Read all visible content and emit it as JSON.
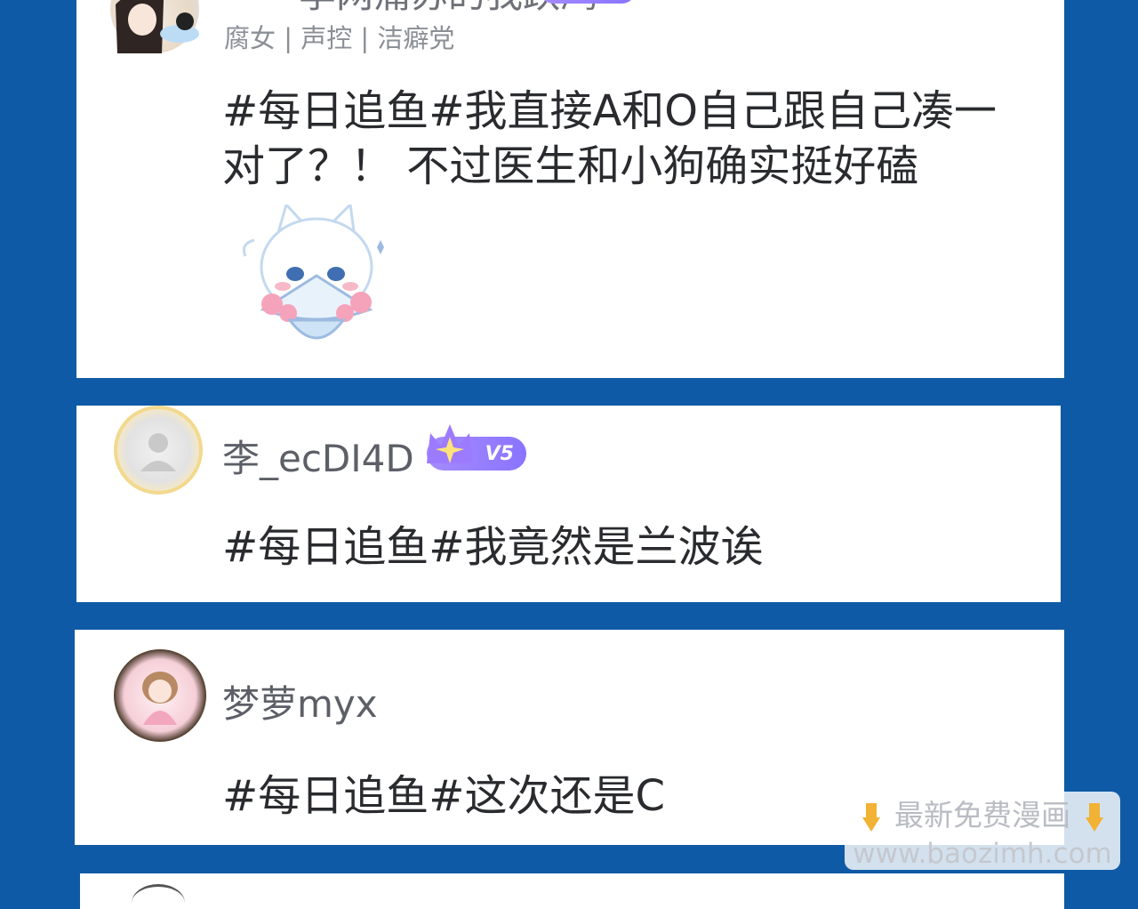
{
  "comments": [
    {
      "username": "李网痛苏的我跃鸿",
      "tags": "腐女 | 声控 | 洁癖党",
      "text_line1": "#每日追鱼#我直接A和O自己跟自己凑一",
      "text_line2": "对了？！ 不过医生和小狗确实挺好磕",
      "sticker": "crying-cat-with-fan-sticker"
    },
    {
      "username": "李_ecDI4D",
      "vip_label": "V5",
      "text_line1": "#每日追鱼#我竟然是兰波诶"
    },
    {
      "username": "梦萝myx",
      "text_line1": "#每日追鱼#这次还是C"
    }
  ],
  "watermark": {
    "line1": "最新免费漫画",
    "line2": "www.baozimh.com",
    "icon": "pointing-down-hand-icon"
  },
  "colors": {
    "background": "#0f5aa6",
    "card": "#ffffff",
    "vip_badge": "#8a74ff"
  }
}
